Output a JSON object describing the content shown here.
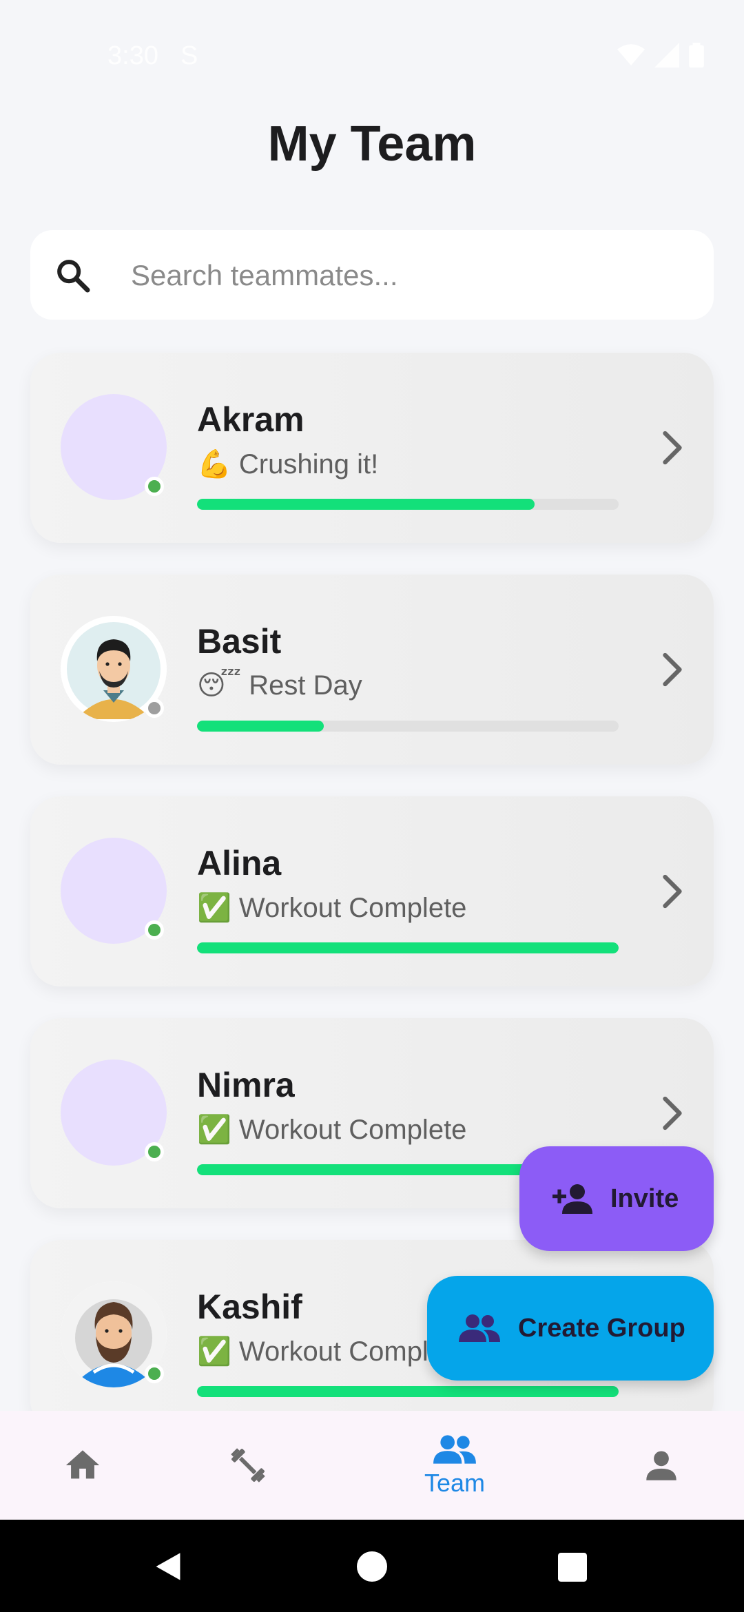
{
  "status_bar": {
    "time": "3:30",
    "symbol": "S"
  },
  "page": {
    "title": "My Team"
  },
  "search": {
    "placeholder": "Search teammates..."
  },
  "teammates": [
    {
      "name": "Akram",
      "status": "💪 Crushing it!",
      "progress": 0.8,
      "online": true,
      "dot_color": "#4caf50"
    },
    {
      "name": "Basit",
      "status": "😴 Rest Day",
      "progress": 0.3,
      "online": false,
      "dot_color": "#9e9e9e"
    },
    {
      "name": "Alina",
      "status": "✅ Workout Complete",
      "progress": 1.0,
      "online": true,
      "dot_color": "#4caf50"
    },
    {
      "name": "Nimra",
      "status": "✅ Workout Complete",
      "progress": 1.0,
      "online": true,
      "dot_color": "#4caf50"
    },
    {
      "name": "Kashif",
      "status": "✅ Workout Complete",
      "progress": 1.0,
      "online": true,
      "dot_color": "#4caf50"
    }
  ],
  "fabs": {
    "invite_label": "Invite",
    "create_group_label": "Create Group"
  },
  "bottom_nav": {
    "items": [
      {
        "icon": "home-icon",
        "label": ""
      },
      {
        "icon": "dumbbell-icon",
        "label": ""
      },
      {
        "icon": "team-icon",
        "label": "Team",
        "active": true
      },
      {
        "icon": "profile-icon",
        "label": ""
      }
    ]
  },
  "colors": {
    "accent": "#1e88e5",
    "progress": "#13e07a",
    "invite_fab": "#8c5cf6",
    "create_group_fab": "#05a5ea",
    "avatar_placeholder": "#e8dffe"
  }
}
